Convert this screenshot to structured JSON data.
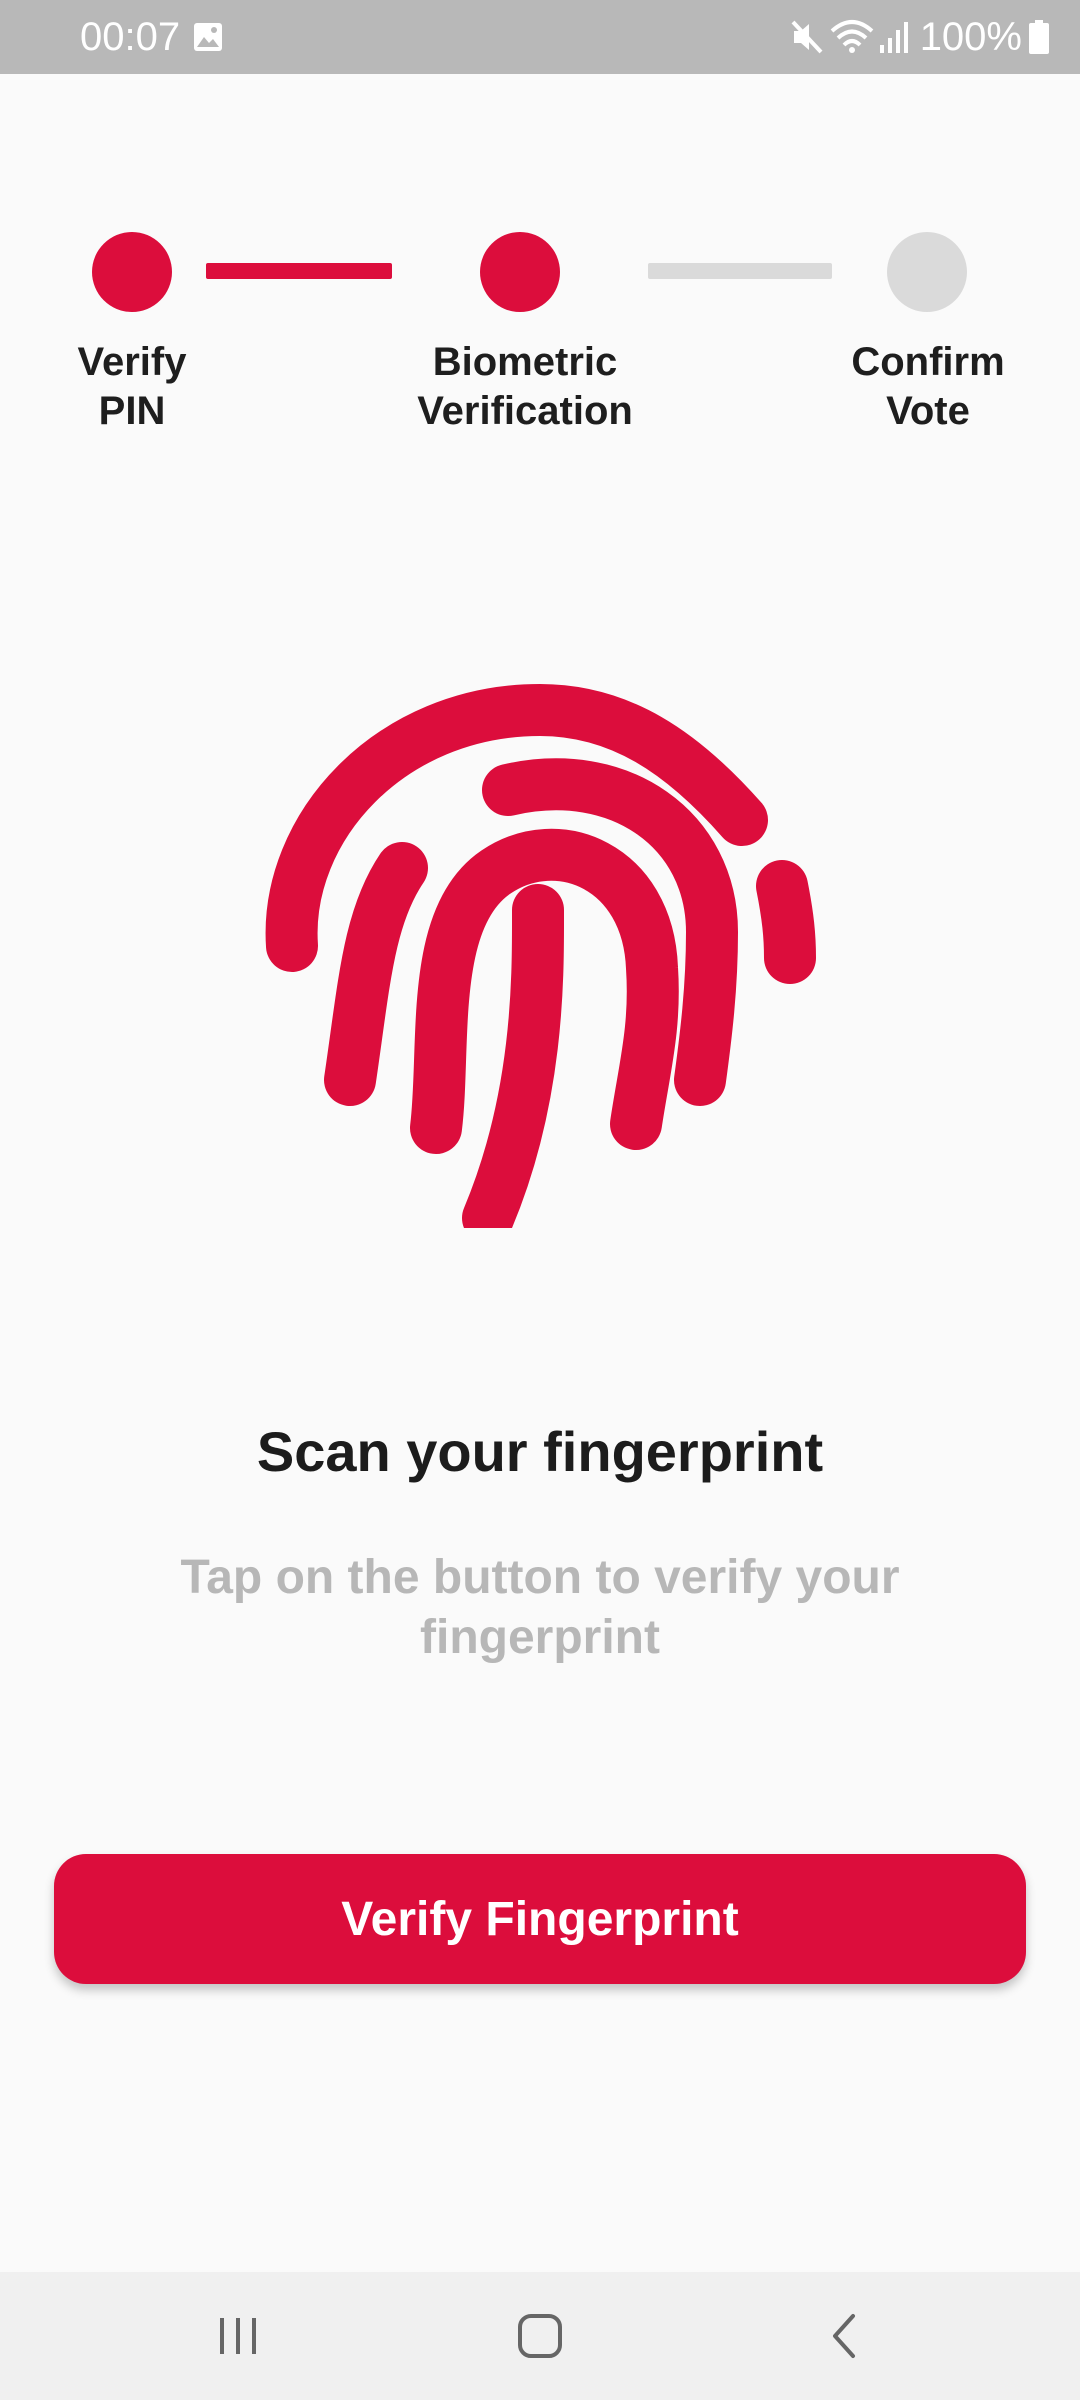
{
  "status_bar": {
    "time": "00:07",
    "battery_percent": "100%",
    "icons": [
      "gallery-icon",
      "mute-icon",
      "wifi-icon",
      "signal-icon",
      "battery-icon"
    ]
  },
  "stepper": {
    "current_step": 2,
    "steps": [
      {
        "label": "Verify\nPIN",
        "state": "completed"
      },
      {
        "label": "Biometric\nVerification",
        "state": "active"
      },
      {
        "label": "Confirm\nVote",
        "state": "pending"
      }
    ]
  },
  "main": {
    "icon": "fingerprint-icon",
    "title": "Scan your fingerprint",
    "subtitle": "Tap on the button to verify your fingerprint",
    "button_label": "Verify Fingerprint"
  },
  "nav_bar": {
    "icons": [
      "recent-apps-icon",
      "home-icon",
      "back-icon"
    ]
  },
  "colors": {
    "accent": "#dc0d3c",
    "inactive": "#dadada",
    "background": "#fafafa",
    "status_bar": "#b8b8b8"
  }
}
